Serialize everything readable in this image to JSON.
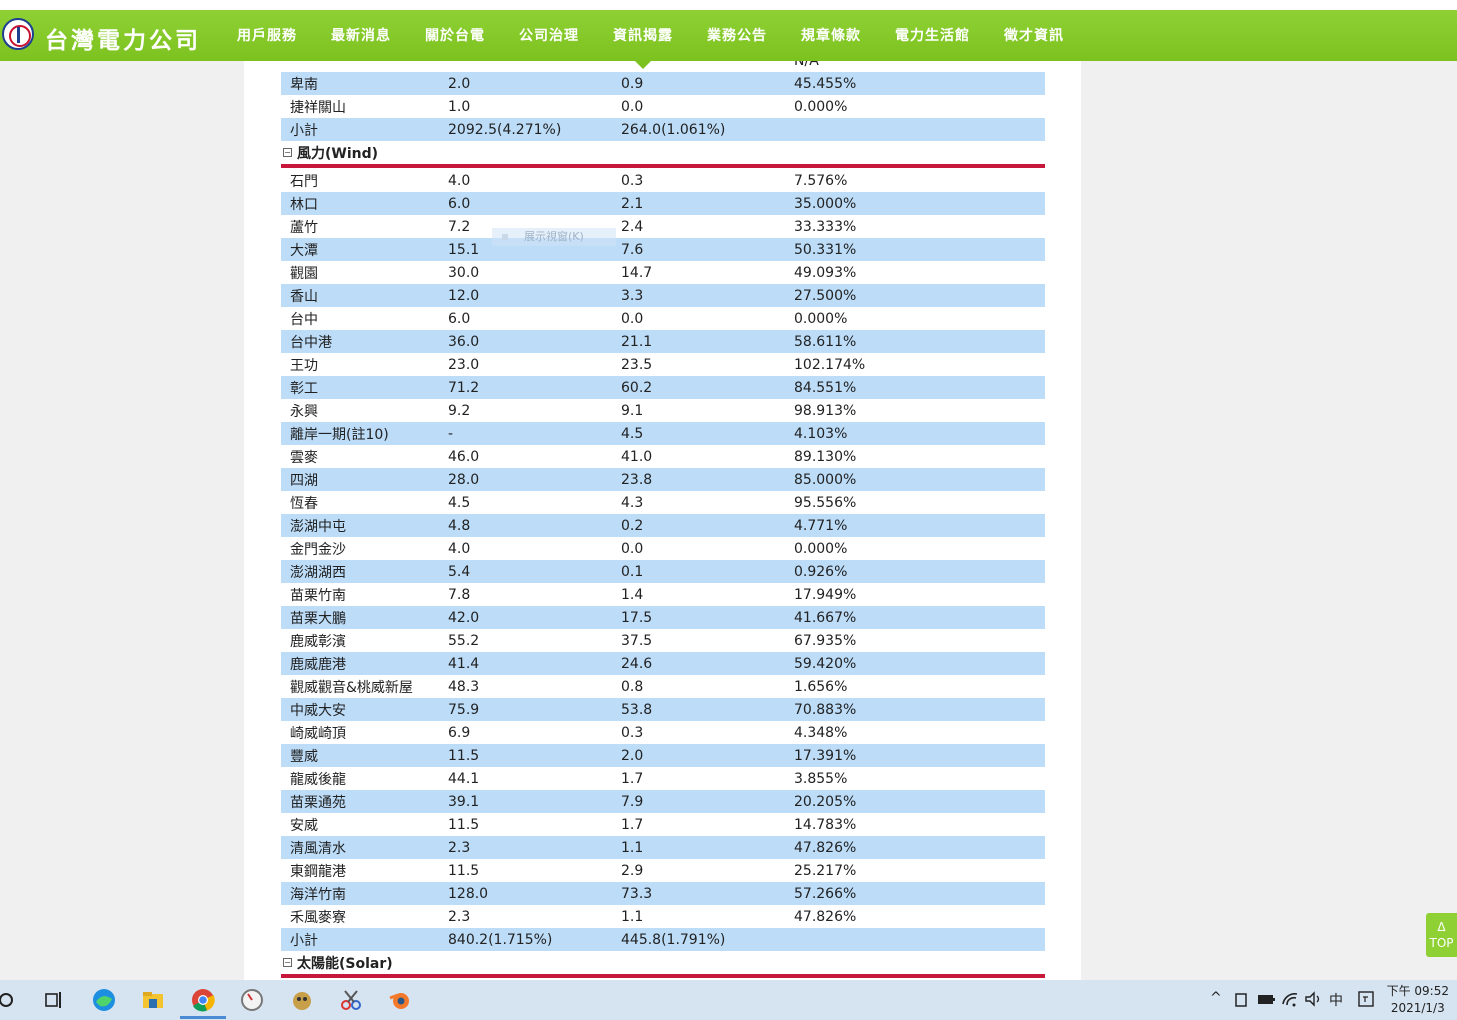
{
  "header": {
    "logo_text": "台灣電力公司",
    "nav": [
      "用戶服務",
      "最新消息",
      "關於台電",
      "公司治理",
      "資訊揭露",
      "業務公告",
      "規章條款",
      "電力生活館",
      "徵才資訊"
    ]
  },
  "top_partial_rows": [
    {
      "name": "",
      "cap": "",
      "gen": "",
      "ratio": "N/A"
    },
    {
      "name": "卑南",
      "cap": "2.0",
      "gen": "0.9",
      "ratio": "45.455%"
    },
    {
      "name": "捷祥關山",
      "cap": "1.0",
      "gen": "0.0",
      "ratio": "0.000%"
    },
    {
      "name": "小計",
      "cap": "2092.5(4.271%)",
      "gen": "264.0(1.061%)",
      "ratio": ""
    }
  ],
  "wind": {
    "title": "風力(Wind)",
    "rows": [
      {
        "name": "石門",
        "cap": "4.0",
        "gen": "0.3",
        "ratio": "7.576%"
      },
      {
        "name": "林口",
        "cap": "6.0",
        "gen": "2.1",
        "ratio": "35.000%"
      },
      {
        "name": "蘆竹",
        "cap": "7.2",
        "gen": "2.4",
        "ratio": "33.333%"
      },
      {
        "name": "大潭",
        "cap": "15.1",
        "gen": "7.6",
        "ratio": "50.331%"
      },
      {
        "name": "觀園",
        "cap": "30.0",
        "gen": "14.7",
        "ratio": "49.093%"
      },
      {
        "name": "香山",
        "cap": "12.0",
        "gen": "3.3",
        "ratio": "27.500%"
      },
      {
        "name": "台中",
        "cap": "6.0",
        "gen": "0.0",
        "ratio": "0.000%"
      },
      {
        "name": "台中港",
        "cap": "36.0",
        "gen": "21.1",
        "ratio": "58.611%"
      },
      {
        "name": "王功",
        "cap": "23.0",
        "gen": "23.5",
        "ratio": "102.174%"
      },
      {
        "name": "彰工",
        "cap": "71.2",
        "gen": "60.2",
        "ratio": "84.551%"
      },
      {
        "name": "永興",
        "cap": "9.2",
        "gen": "9.1",
        "ratio": "98.913%"
      },
      {
        "name": "離岸一期(註10)",
        "cap": "-",
        "gen": "4.5",
        "ratio": "4.103%"
      },
      {
        "name": "雲麥",
        "cap": "46.0",
        "gen": "41.0",
        "ratio": "89.130%"
      },
      {
        "name": "四湖",
        "cap": "28.0",
        "gen": "23.8",
        "ratio": "85.000%"
      },
      {
        "name": "恆春",
        "cap": "4.5",
        "gen": "4.3",
        "ratio": "95.556%"
      },
      {
        "name": "澎湖中屯",
        "cap": "4.8",
        "gen": "0.2",
        "ratio": "4.771%"
      },
      {
        "name": "金門金沙",
        "cap": "4.0",
        "gen": "0.0",
        "ratio": "0.000%"
      },
      {
        "name": "澎湖湖西",
        "cap": "5.4",
        "gen": "0.1",
        "ratio": "0.926%"
      },
      {
        "name": "苗栗竹南",
        "cap": "7.8",
        "gen": "1.4",
        "ratio": "17.949%"
      },
      {
        "name": "苗栗大鵬",
        "cap": "42.0",
        "gen": "17.5",
        "ratio": "41.667%"
      },
      {
        "name": "鹿威彰濱",
        "cap": "55.2",
        "gen": "37.5",
        "ratio": "67.935%"
      },
      {
        "name": "鹿威鹿港",
        "cap": "41.4",
        "gen": "24.6",
        "ratio": "59.420%"
      },
      {
        "name": "觀威觀音&桃威新屋",
        "cap": "48.3",
        "gen": "0.8",
        "ratio": "1.656%"
      },
      {
        "name": "中威大安",
        "cap": "75.9",
        "gen": "53.8",
        "ratio": "70.883%"
      },
      {
        "name": "崎威崎頂",
        "cap": "6.9",
        "gen": "0.3",
        "ratio": "4.348%"
      },
      {
        "name": "豐威",
        "cap": "11.5",
        "gen": "2.0",
        "ratio": "17.391%"
      },
      {
        "name": "龍威後龍",
        "cap": "44.1",
        "gen": "1.7",
        "ratio": "3.855%"
      },
      {
        "name": "苗栗通苑",
        "cap": "39.1",
        "gen": "7.9",
        "ratio": "20.205%"
      },
      {
        "name": "安威",
        "cap": "11.5",
        "gen": "1.7",
        "ratio": "14.783%"
      },
      {
        "name": "清風清水",
        "cap": "2.3",
        "gen": "1.1",
        "ratio": "47.826%"
      },
      {
        "name": "東鋼龍港",
        "cap": "11.5",
        "gen": "2.9",
        "ratio": "25.217%"
      },
      {
        "name": "海洋竹南",
        "cap": "128.0",
        "gen": "73.3",
        "ratio": "57.266%"
      },
      {
        "name": "禾風麥寮",
        "cap": "2.3",
        "gen": "1.1",
        "ratio": "47.826%"
      },
      {
        "name": "小計",
        "cap": "840.2(1.715%)",
        "gen": "445.8(1.791%)",
        "ratio": ""
      }
    ]
  },
  "solar": {
    "title": "太陽能(Solar)"
  },
  "tooltip_text": "展示視窗(K)",
  "top_button": "Δ TOP",
  "taskbar": {
    "ime": "中",
    "time": "下午 09:52",
    "date": "2021/1/3",
    "colors": {
      "accent": "#7cc21f",
      "divider": "#c7183c",
      "row_alt": "#bcdcf8"
    }
  }
}
